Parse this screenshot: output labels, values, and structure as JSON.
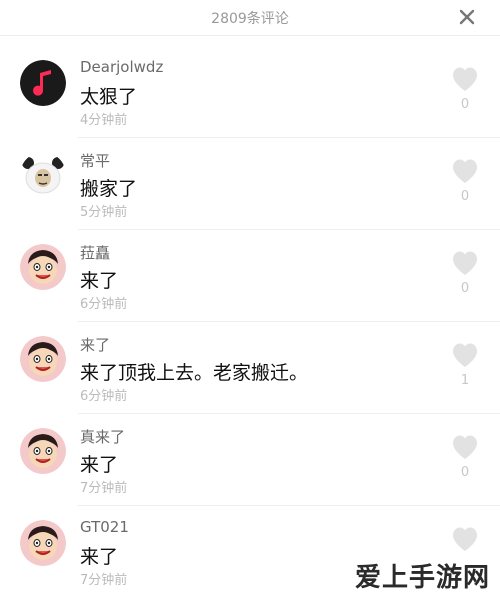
{
  "header": {
    "title": "2809条评论",
    "close_icon": "close-icon"
  },
  "colors": {
    "like_icon": "#e2e2e2",
    "username": "#6a6a6a",
    "time": "#bbbbbb",
    "music_avatar_bg": "#1a1a1a",
    "music_note": "#ff2a55"
  },
  "comments": [
    {
      "username": "Dearjolwdz",
      "text": "太狠了",
      "time": "4分钟前",
      "likes": "0",
      "avatar": "music-app-avatar"
    },
    {
      "username": "常平",
      "text": "搬家了",
      "time": "5分钟前",
      "likes": "0",
      "avatar": "panda-meme-avatar"
    },
    {
      "username": "菈矗",
      "text": "来了",
      "time": "6分钟前",
      "likes": "0",
      "avatar": "cartoon-face-avatar"
    },
    {
      "username": "来了",
      "text": "来了顶我上去。老家搬迁。",
      "time": "6分钟前",
      "likes": "1",
      "avatar": "cartoon-face-avatar"
    },
    {
      "username": "真来了",
      "text": "来了",
      "time": "7分钟前",
      "likes": "0",
      "avatar": "cartoon-face-avatar"
    },
    {
      "username": "GT021",
      "text": "来了",
      "time": "7分钟前",
      "likes": "",
      "avatar": "cartoon-face-avatar"
    }
  ],
  "watermark": "爱上手游网"
}
